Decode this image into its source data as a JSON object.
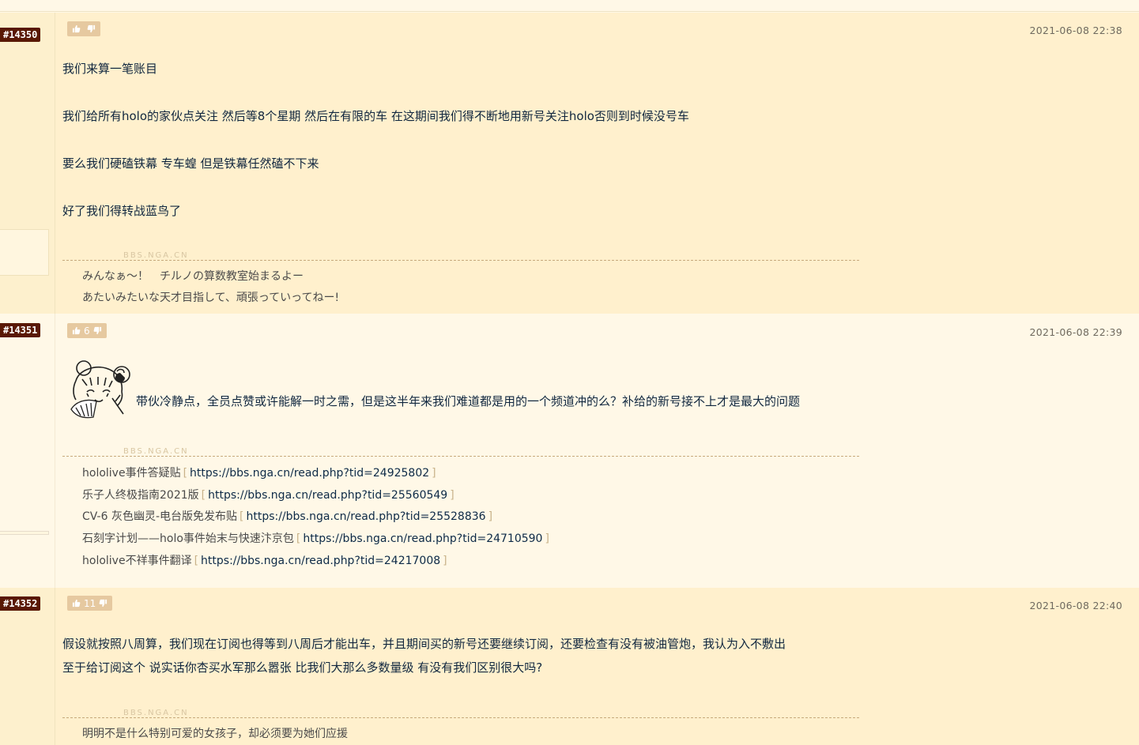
{
  "posts": [
    {
      "floor": "#14350",
      "time": "2021-06-08 22:38",
      "likes": "",
      "lines": [
        "我们来算一笔账目",
        "我们给所有holo的家伙点关注 然后等8个星期 然后在有限的车 在这期间我们得不断地用新号关注holo否则到时候没号车",
        "要么我们硬磕铁幕 专车蝗 但是铁幕任然磕不下来",
        "好了我们得转战蓝鸟了"
      ],
      "sig_tag": "BBS.NGA.CN",
      "signature": [
        "みんなぁ～！　チルノの算数教室始まるよー",
        "あたいみたいな天才目指して、頑張っていってねー!"
      ]
    },
    {
      "floor": "#14351",
      "time": "2021-06-08 22:39",
      "likes": "6",
      "lines": [
        "带伙冷静点，全员点赞或许能解一时之需，但是这半年来我们难道都是用的一个频道冲的么？补给的新号接不上才是最大的问题"
      ],
      "sig_tag": "BBS.NGA.CN",
      "sig_links": [
        {
          "label": "hololive事件答疑贴",
          "url": "https://bbs.nga.cn/read.php?tid=24925802"
        },
        {
          "label": "乐子人终极指南2021版",
          "url": "https://bbs.nga.cn/read.php?tid=25560549"
        },
        {
          "label": "CV-6 灰色幽灵-电台版免发布贴",
          "url": "https://bbs.nga.cn/read.php?tid=25528836"
        },
        {
          "label": "石刻字计划——holo事件始末与快速汴京包",
          "url": "https://bbs.nga.cn/read.php?tid=24710590"
        },
        {
          "label": "hololive不祥事件翻译",
          "url": "https://bbs.nga.cn/read.php?tid=24217008"
        }
      ],
      "bracket_open": "[",
      "bracket_close": "]"
    },
    {
      "floor": "#14352",
      "time": "2021-06-08 22:40",
      "likes": "11",
      "lines": [
        "假设就按照八周算，我们现在订阅也得等到八周后才能出车，并且期间买的新号还要继续订阅，还要检查有没有被油管炮，我认为入不敷出",
        "至于给订阅这个 说实话你杏买水军那么嚣张 比我们大那么多数量级 有没有我们区别很大吗?"
      ],
      "sig_tag": "BBS.NGA.CN",
      "signature": [
        "明明不是什么特别可爱的女孩子，却必须要为她们应援"
      ]
    }
  ]
}
